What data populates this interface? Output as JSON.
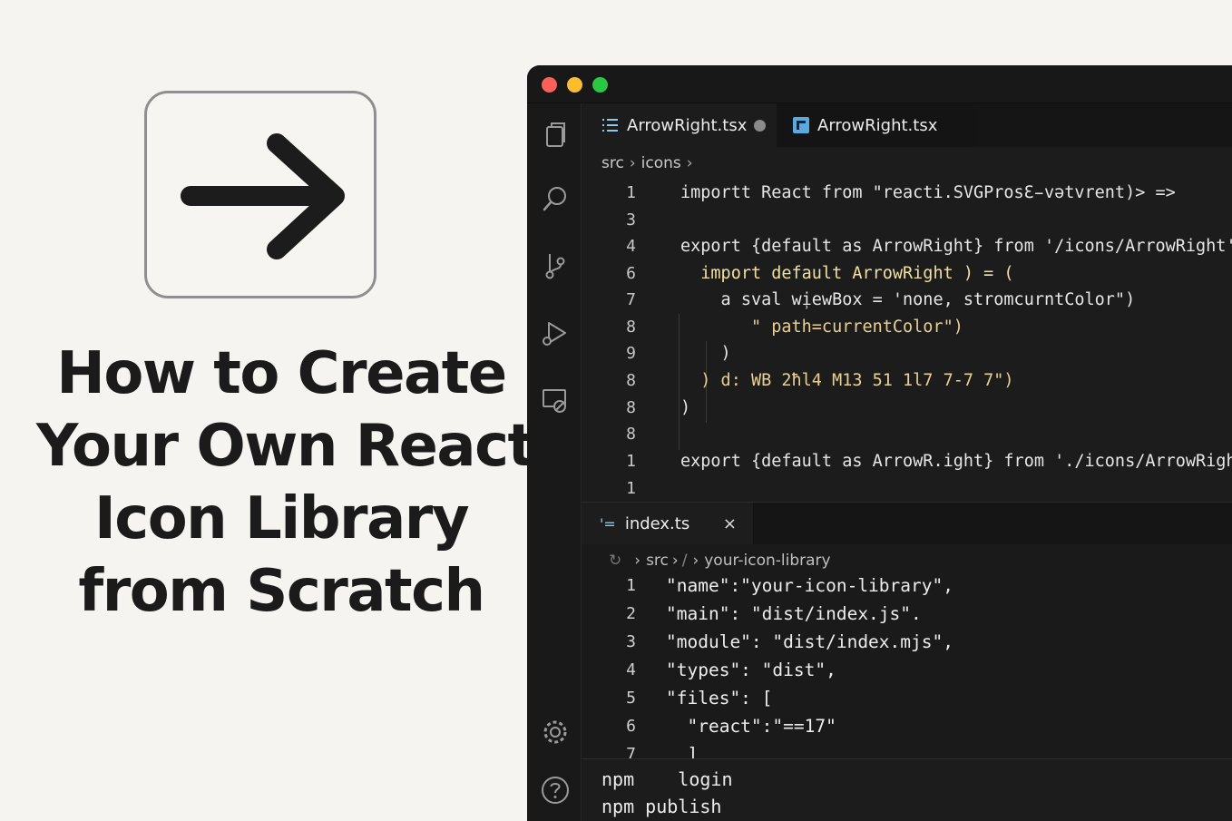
{
  "hero": {
    "title_lines": [
      "How to Create",
      "Your Own React",
      "Icon Library",
      "from Scratch"
    ],
    "icon": "arrow-right-icon"
  },
  "window": {
    "traffic_lights": {
      "close": "#fe5f57",
      "minimize": "#febc2e",
      "maximize": "#28c840"
    }
  },
  "activity_bar": {
    "items": [
      "files-icon",
      "search-icon",
      "source-control-icon",
      "run-debug-icon",
      "remote-explorer-icon",
      "settings-gear-icon",
      "help-icon"
    ]
  },
  "editor": {
    "tabs": [
      {
        "label": "ArrowRight.tsx",
        "icon": "list-icon",
        "modified": true
      },
      {
        "label": "ArrowRight.tsx",
        "icon": "react-file-icon"
      }
    ],
    "breadcrumb": [
      "src",
      "icons"
    ],
    "lines": [
      {
        "num": "1",
        "text": "importt React from \"reacti.SVGProsƐ̵vətvrent)> =>"
      },
      {
        "num": "3",
        "text": ""
      },
      {
        "num": "4",
        "text": "export {default as ArrowRight} from '/icons/ArrowRight'"
      },
      {
        "num": "6",
        "text": "  import default ArrowRight ) = ("
      },
      {
        "num": "7",
        "text": "    a sval wi̹ewBox = 'none, stromcurntColor\")"
      },
      {
        "num": "8",
        "text": "       \" path=currentColor\")"
      },
      {
        "num": "9",
        "text": "    )"
      },
      {
        "num": "8",
        "text": "  ) d: WB 2ħl4 M13 51 1l7 7-7 7\")"
      },
      {
        "num": "8",
        "text": ")"
      },
      {
        "num": "8",
        "text": ""
      },
      {
        "num": "1",
        "text": "export {default as ArrowR.ight} from './icons/ArrowRight'"
      },
      {
        "num": "1",
        "text": ""
      }
    ]
  },
  "panel": {
    "tab": {
      "label": "index.ts",
      "icon_text": "'=",
      "close": "×"
    },
    "breadcrumb": [
      "src",
      "/",
      "your-icon-library"
    ],
    "lines": [
      {
        "num": "1",
        "text": "\"name\":\"your-icon-library\","
      },
      {
        "num": "2",
        "text": "\"main\": \"dist/index.js\"."
      },
      {
        "num": "3",
        "text": "\"module\": \"dist/index.mjs\","
      },
      {
        "num": "4",
        "text": "\"types\": \"dist\","
      },
      {
        "num": "5",
        "text": "\"files\": ["
      },
      {
        "num": "6",
        "text": "  \"react\":\"==17\""
      },
      {
        "num": "7",
        "text": "  ]"
      }
    ]
  },
  "terminal": {
    "lines": [
      "npm    login",
      "npm publish"
    ]
  }
}
